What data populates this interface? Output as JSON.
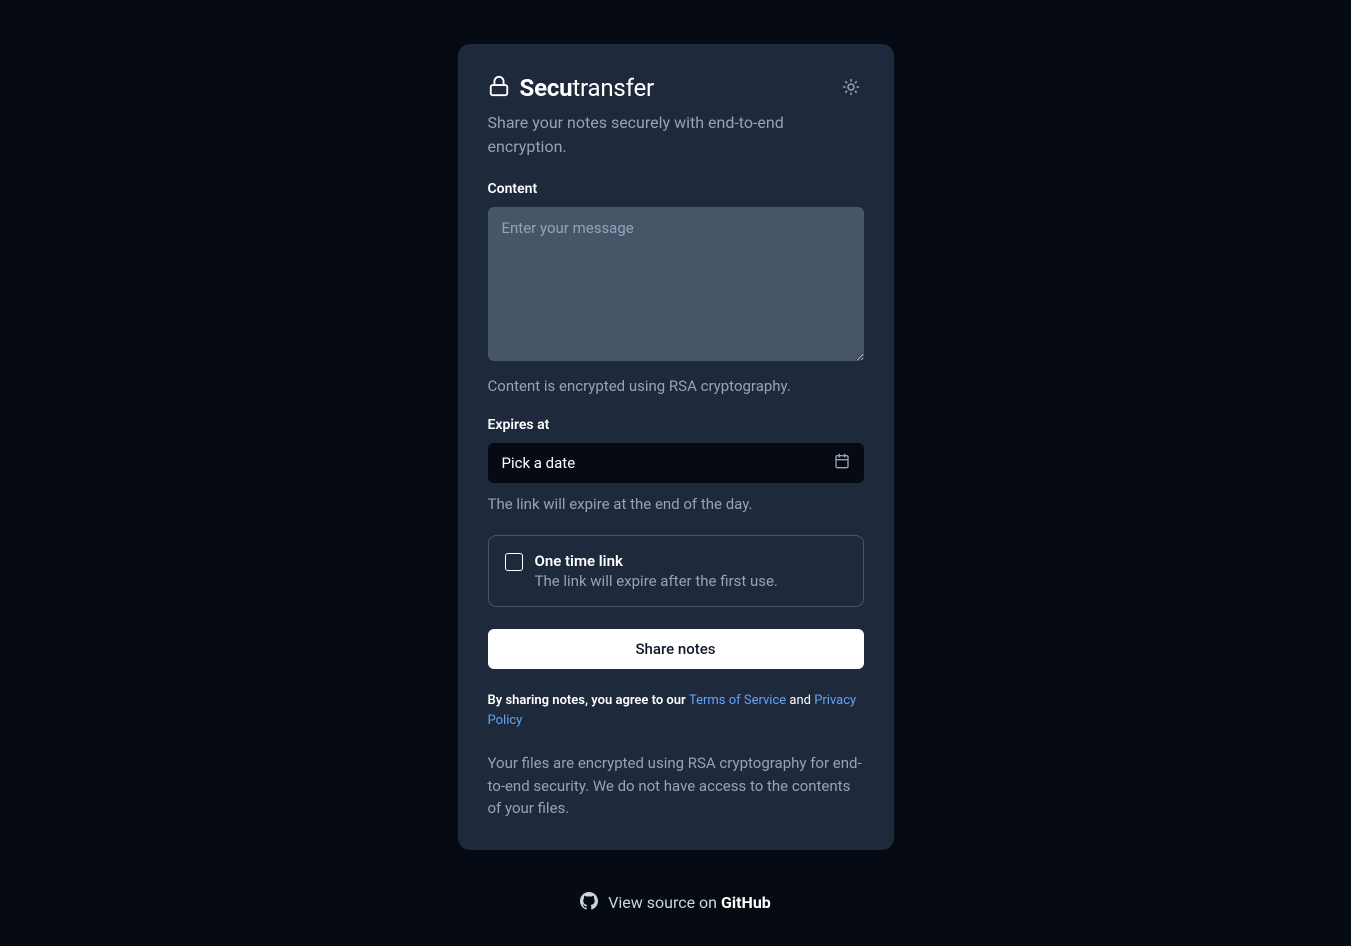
{
  "brand": {
    "name_bold": "Secu",
    "name_rest": "transfer"
  },
  "subtitle": "Share your notes securely with end-to-end encryption.",
  "form": {
    "content_label": "Content",
    "content_placeholder": "Enter your message",
    "content_help": "Content is encrypted using RSA cryptography.",
    "expires_label": "Expires at",
    "expires_placeholder": "Pick a date",
    "expires_help": "The link will expire at the end of the day.",
    "onetime_title": "One time link",
    "onetime_desc": "The link will expire after the first use.",
    "submit_label": "Share notes"
  },
  "legal": {
    "prefix": "By sharing notes, you agree to our ",
    "terms_label": "Terms of Service",
    "and": " and ",
    "privacy_label": "Privacy Policy"
  },
  "footer_note": "Your files are encrypted using RSA cryptography for end-to-end security. We do not have access to the contents of your files.",
  "github": {
    "prefix": "View source on ",
    "bold": "GitHub"
  }
}
